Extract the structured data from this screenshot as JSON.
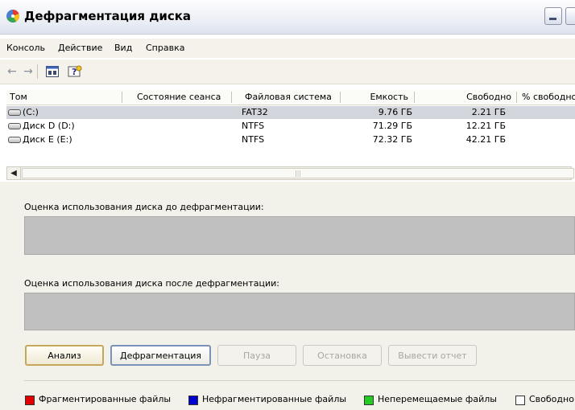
{
  "window": {
    "title": "Дефрагментация диска"
  },
  "menu": [
    "Консоль",
    "Действие",
    "Вид",
    "Справка"
  ],
  "toolbar": {
    "back_icon": "arrow-left-icon",
    "forward_icon": "arrow-right-icon",
    "properties_icon": "properties-icon",
    "help_icon": "help-icon"
  },
  "volumes": {
    "columns": [
      "Том",
      "Состояние сеанса",
      "Файловая система",
      "Емкость",
      "Свободно",
      "% свободно"
    ],
    "rows": [
      {
        "name": "(C:)",
        "state": "",
        "fs": "FAT32",
        "capacity": "9.76 ГБ",
        "free": "2.21 ГБ",
        "free_pct": ""
      },
      {
        "name": "Диск D (D:)",
        "state": "",
        "fs": "NTFS",
        "capacity": "71.29 ГБ",
        "free": "12.21 ГБ",
        "free_pct": ""
      },
      {
        "name": "Диск E (E:)",
        "state": "",
        "fs": "NTFS",
        "capacity": "72.32 ГБ",
        "free": "42.21 ГБ",
        "free_pct": ""
      }
    ],
    "selected_row": 0
  },
  "analysis": {
    "before_label": "Оценка использования диска до дефрагментации:",
    "after_label": "Оценка использования диска после дефрагментации:"
  },
  "buttons": {
    "analyze": "Анализ",
    "defragment": "Дефрагментация",
    "pause": "Пауза",
    "stop": "Остановка",
    "report": "Вывести отчет"
  },
  "legend": [
    {
      "label": "Фрагментированные файлы",
      "color": "#e00000"
    },
    {
      "label": "Нефрагментированные файлы",
      "color": "#0000d0"
    },
    {
      "label": "Неперемещаемые файлы",
      "color": "#22cc22"
    },
    {
      "label": "Свободно",
      "color": "#ffffff"
    }
  ]
}
